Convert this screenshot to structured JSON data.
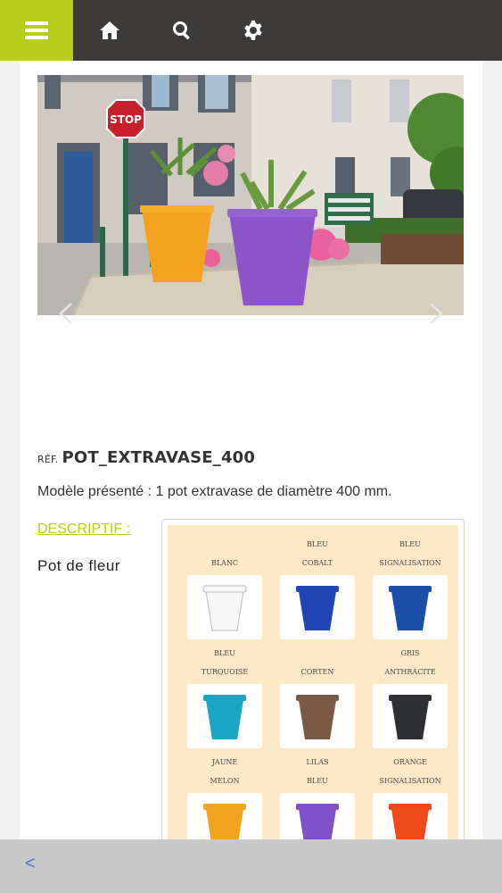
{
  "topbar": {
    "menu_icon": "hamburger-menu-icon",
    "icons": [
      "home-icon",
      "search-icon",
      "gear-icon"
    ],
    "accent": "#b7cd1c",
    "bar_color": "#3c3b3a"
  },
  "hero": {
    "sign_text": "STOP",
    "prev_icon": "chevron-left-icon",
    "next_icon": "chevron-right-icon"
  },
  "product": {
    "ref_prefix": "RÉF.",
    "ref_code": "POT_EXTRAVASE_400",
    "model_text": "Modèle présenté : 1 pot extravase de diamètre 400 mm.",
    "descriptif_label": "DESCRIPTIF :",
    "title": "Pot de fleur"
  },
  "swatches": [
    {
      "line1": "",
      "line2": "blanc",
      "color": "#f7f7f7"
    },
    {
      "line1": "bleu",
      "line2": "cobalt",
      "color": "#1f45b5"
    },
    {
      "line1": "bleu",
      "line2": "signalisation",
      "color": "#1b4fa8"
    },
    {
      "line1": "bleu",
      "line2": "turquoise",
      "color": "#1aa6c4"
    },
    {
      "line1": "",
      "line2": "corten",
      "color": "#7a5a45"
    },
    {
      "line1": "gris",
      "line2": "anthracite",
      "color": "#2f3033"
    },
    {
      "line1": "jaune",
      "line2": "melon",
      "color": "#f1a21e"
    },
    {
      "line1": "lilas",
      "line2": "bleu",
      "color": "#8051c9"
    },
    {
      "line1": "orange",
      "line2": "signalisation",
      "color": "#ef4a17"
    }
  ],
  "bottombar": {
    "back_label": "<"
  }
}
